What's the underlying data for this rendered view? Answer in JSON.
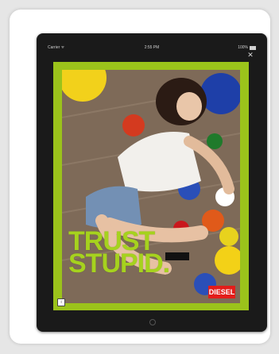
{
  "statusbar": {
    "carrier": "Carrier ᯤ",
    "time": "2:55 PM",
    "battery": "100%"
  },
  "overlay": {
    "close_icon": "close-icon",
    "close_glyph": "✕"
  },
  "ad": {
    "headline": "TRUST STUPID.",
    "headline_line1": "TRUST",
    "headline_line2": "STUPID.",
    "brand": "DIESEL",
    "frame_color": "#9bc31b",
    "headline_color": "#a6d21e",
    "brand_color": "#e31d1a"
  },
  "device": {
    "home_button_icon": "home-button-icon"
  }
}
